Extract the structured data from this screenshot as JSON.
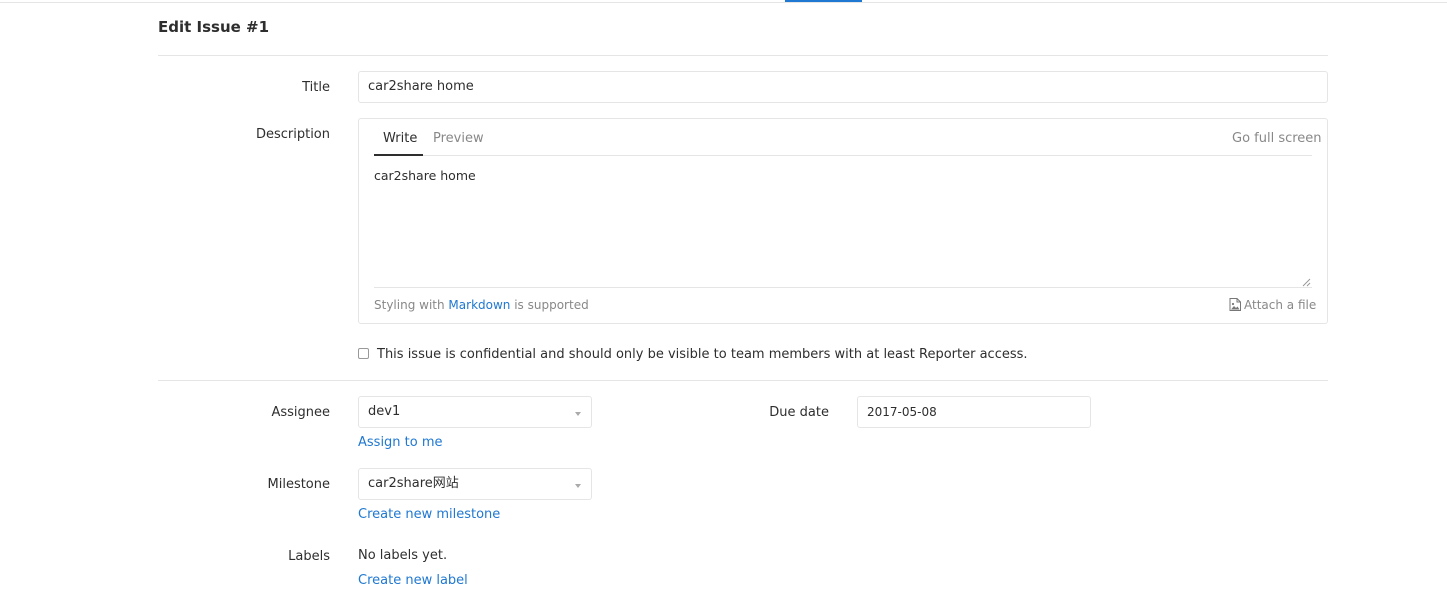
{
  "page": {
    "title": "Edit Issue #1"
  },
  "form": {
    "title_label": "Title",
    "title_value": "car2share home",
    "description_label": "Description",
    "tabs": [
      {
        "label": "Write"
      },
      {
        "label": "Preview"
      }
    ],
    "full_screen_label": "Go full screen",
    "description_value": "car2share home",
    "markdown_prefix": "Styling with",
    "markdown_link": "Markdown",
    "markdown_suffix": "is supported",
    "attach_label": "Attach a file",
    "confidential_label": "This issue is confidential and should only be visible to team members with at least Reporter access.",
    "assignee_label": "Assignee",
    "assignee_value": "dev1",
    "assign_to_me": "Assign to me",
    "due_date_label": "Due date",
    "due_date_value": "2017-05-08",
    "milestone_label": "Milestone",
    "milestone_value": "car2share网站",
    "create_milestone": "Create new milestone",
    "labels_label": "Labels",
    "labels_value": "No labels yet.",
    "create_label": "Create new label"
  },
  "icons": {
    "attach": "image-file-icon",
    "dropdown": "caret-down-icon"
  },
  "colors": {
    "link": "#1f78d1",
    "muted": "#888888",
    "border": "#e5e5e5"
  }
}
